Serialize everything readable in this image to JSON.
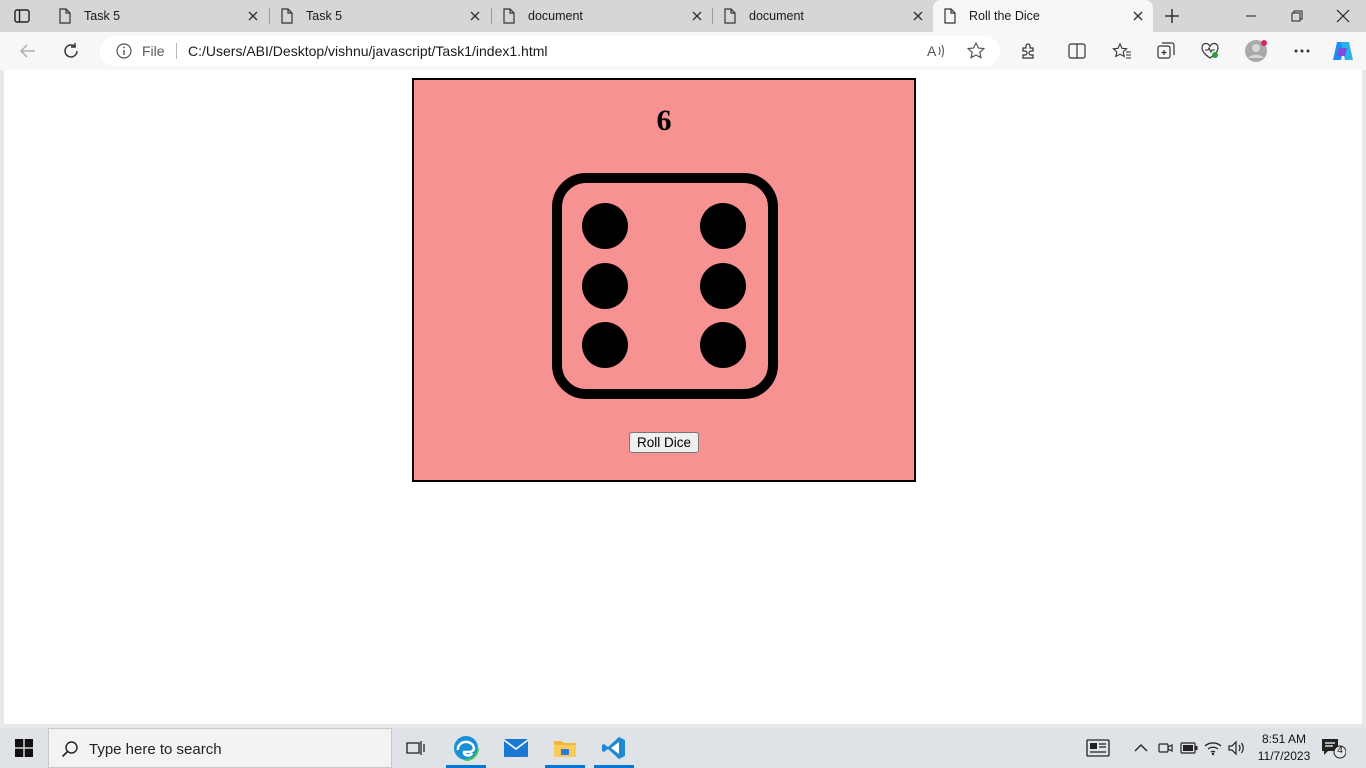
{
  "browser": {
    "tabs": [
      {
        "title": "Task 5"
      },
      {
        "title": "Task 5"
      },
      {
        "title": "document"
      },
      {
        "title": "document"
      },
      {
        "title": "Roll the Dice",
        "active": true
      }
    ],
    "address": {
      "scheme_label": "File",
      "url": "C:/Users/ABI/Desktop/vishnu/javascript/Task1/index1.html"
    }
  },
  "page": {
    "dice_value": "6",
    "roll_button_label": "Roll Dice",
    "card_color": "#f79292"
  },
  "taskbar": {
    "search_placeholder": "Type here to search",
    "time": "8:51 AM",
    "date": "11/7/2023",
    "notification_count": "4"
  }
}
